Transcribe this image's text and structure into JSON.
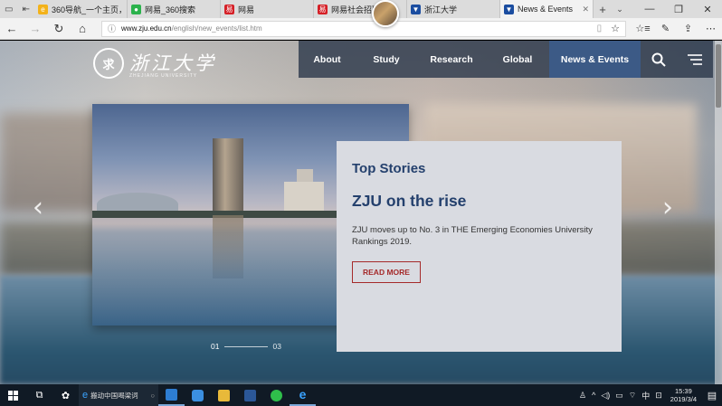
{
  "browser": {
    "tabs": [
      {
        "label": "360导航_一个主页，整",
        "favicon_color": "#f3b21a",
        "active": false
      },
      {
        "label": "网易_360搜索",
        "favicon_color": "#2bb24c",
        "active": false
      },
      {
        "label": "网易",
        "favicon_color": "#d51f26",
        "active": false
      },
      {
        "label": "网易社会招聘",
        "favicon_color": "#d51f26",
        "active": false
      },
      {
        "label": "浙江大学",
        "favicon_color": "#1b4da0",
        "active": false
      },
      {
        "label": "News & Events",
        "favicon_color": "#1b4da0",
        "active": true
      }
    ],
    "url_host": "www.zju.edu.cn",
    "url_path": "/english/new_events/list.htm"
  },
  "site": {
    "logo_text": "浙江大学",
    "logo_sub": "ZHEJIANG UNIVERSITY",
    "nav": [
      "About",
      "Study",
      "Research",
      "Global",
      "News & Events"
    ],
    "nav_active": "News & Events",
    "story": {
      "kicker": "Top Stories",
      "title": "ZJU on the rise",
      "description": "ZJU moves up to No. 3 in THE Emerging Economies University Rankings 2019.",
      "button": "READ MORE"
    },
    "pager": {
      "current": "01",
      "total": "03"
    },
    "colors": {
      "navy": "#24406d",
      "accent_red": "#a52a2a",
      "nav_active_bg": "#3c5a86"
    }
  },
  "taskbar": {
    "search_text": "搬动中国喝梁词",
    "ime": "中",
    "time": "15:39",
    "date": "2019/3/4"
  }
}
